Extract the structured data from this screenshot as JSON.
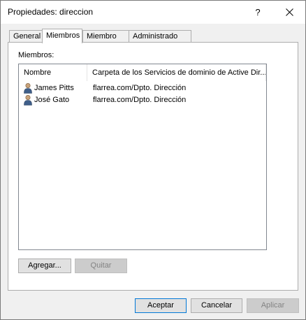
{
  "window": {
    "title": "Propiedades: direccion",
    "help_label": "?"
  },
  "tabs": [
    {
      "label": "General"
    },
    {
      "label": "Miembros",
      "active": true
    },
    {
      "label": "Miembro de"
    },
    {
      "label": "Administrado por"
    }
  ],
  "members": {
    "label": "Miembros:",
    "columns": [
      "Nombre",
      "Carpeta de los Servicios de dominio de Active Dir..."
    ],
    "rows": [
      {
        "name": "James Pitts",
        "folder": "flarrea.com/Dpto. Dirección",
        "icon": "user-icon"
      },
      {
        "name": "José Gato",
        "folder": "flarrea.com/Dpto. Dirección",
        "icon": "user-icon"
      }
    ],
    "add_label": "Agregar...",
    "remove_label": "Quitar"
  },
  "footer": {
    "ok_label": "Aceptar",
    "cancel_label": "Cancelar",
    "apply_label": "Aplicar"
  }
}
